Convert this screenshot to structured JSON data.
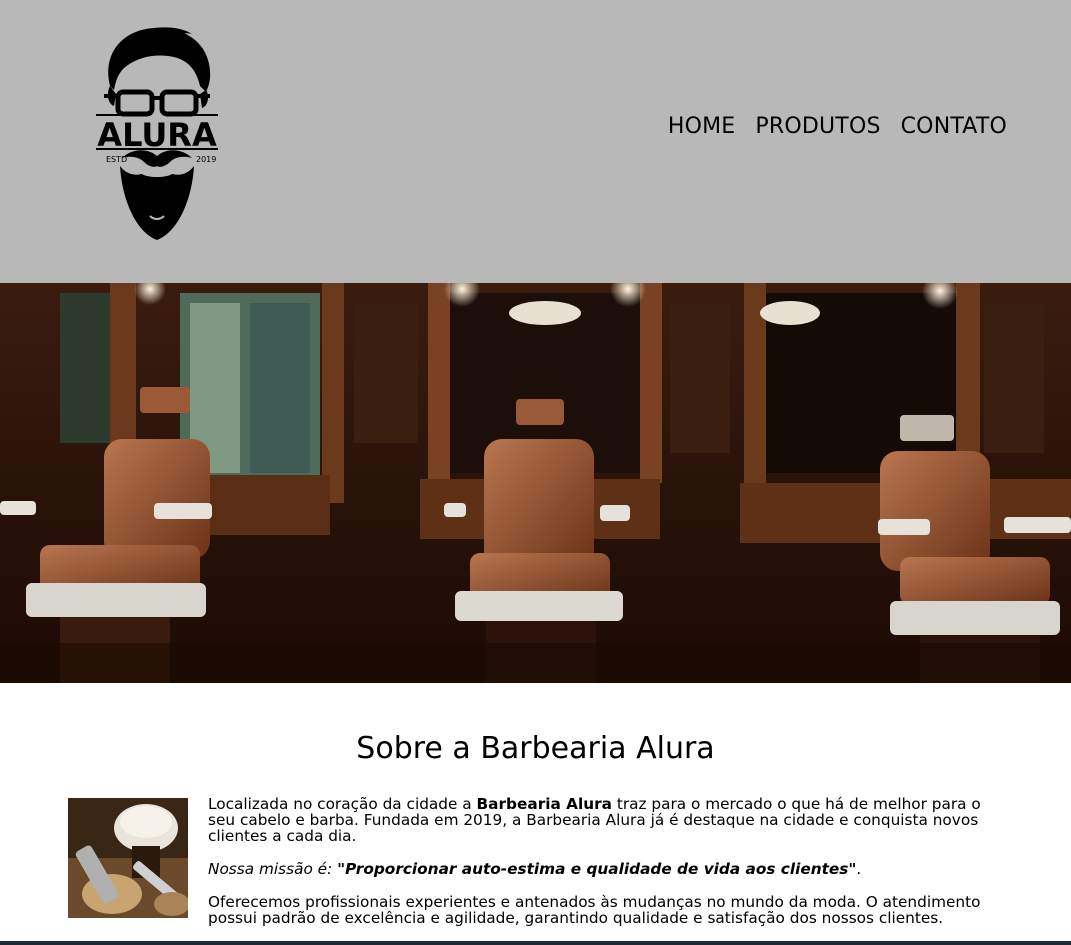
{
  "header": {
    "logo": {
      "brand": "ALURA",
      "estd_label": "ESTD",
      "estd_year": "2019",
      "icon": "bearded-man-logo-icon"
    },
    "nav": [
      {
        "label": "HOME"
      },
      {
        "label": "PRODUTOS"
      },
      {
        "label": "CONTATO"
      }
    ]
  },
  "banner": {
    "icon": "barbershop-interior-photo"
  },
  "about": {
    "title": "Sobre a Barbearia Alura",
    "photo_icon": "shaving-brush-razor-photo",
    "paragraph1": {
      "before": "Localizada no coração da cidade a ",
      "bold": "Barbearia Alura",
      "after": " traz para o mercado o que há de melhor para o seu cabelo e barba. Fundada em 2019, a Barbearia Alura já é destaque na cidade e conquista novos clientes a cada dia."
    },
    "mission": {
      "label": "Nossa missão é: ",
      "quote": "\"Proporcionar auto-estima e qualidade de vida aos clientes\"",
      "end": "."
    },
    "paragraph3": "Oferecemos profissionais experientes e antenados às mudanças no mundo da moda. O atendimento possui padrão de excelência e agilidade, garantindo qualidade e satisfação dos nossos clientes."
  },
  "colors": {
    "header_bg": "#b8b8b8",
    "text": "#000000",
    "banner_dark": "#2a140a",
    "leather": "#8a4a2c"
  }
}
